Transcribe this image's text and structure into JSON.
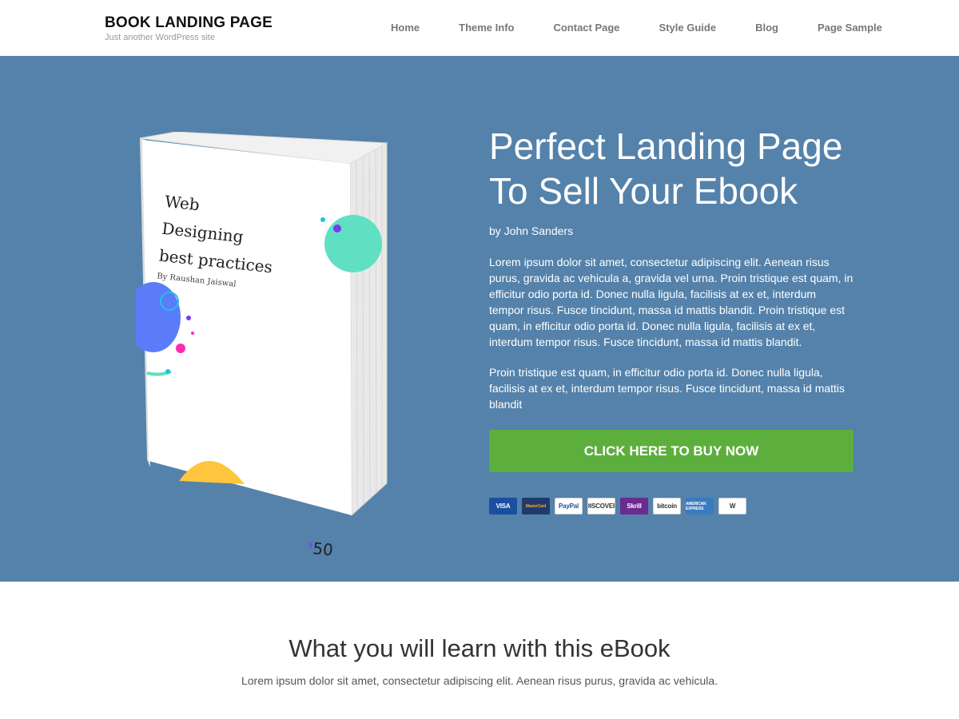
{
  "site": {
    "title": "BOOK LANDING PAGE",
    "tagline": "Just another WordPress site"
  },
  "nav": {
    "items": [
      {
        "label": "Home"
      },
      {
        "label": "Theme Info"
      },
      {
        "label": "Contact Page"
      },
      {
        "label": "Style Guide"
      },
      {
        "label": "Blog"
      },
      {
        "label": "Page Sample"
      }
    ]
  },
  "book": {
    "title_lines": [
      "Web",
      "Designing",
      "best practices"
    ],
    "author": "By Raushan Jaiswal",
    "price_symbol": "$",
    "price": "50"
  },
  "hero": {
    "title": "Perfect Landing Page To Sell Your Ebook",
    "author": "by John Sanders",
    "paragraph1": "Lorem ipsum dolor sit amet, consectetur adipiscing elit. Aenean risus purus, gravida ac vehicula a, gravida vel urna. Proin tristique est quam, in efficitur odio porta id. Donec nulla ligula, facilisis at ex et, interdum tempor risus. Fusce tincidunt, massa id mattis blandit. Proin tristique est quam, in efficitur odio porta id. Donec nulla ligula, facilisis at ex et, interdum tempor risus. Fusce tincidunt, massa id mattis blandit.",
    "paragraph2": "Proin tristique est quam, in efficitur odio porta id. Donec nulla ligula, facilisis at ex et, interdum tempor risus. Fusce tincidunt, massa id mattis blandit",
    "button_label": "CLICK HERE TO BUY NOW",
    "payments": [
      {
        "label": "VISA",
        "bg": "#1a4fa0",
        "color": "#ffffff"
      },
      {
        "label": "MasterCard",
        "bg": "#1f3b6e",
        "color": "#f5a623"
      },
      {
        "label": "PayPal",
        "bg": "#ffffff",
        "color": "#1a4fa0"
      },
      {
        "label": "DISCOVER",
        "bg": "#ffffff",
        "color": "#333333"
      },
      {
        "label": "Skrill",
        "bg": "#6b2a8f",
        "color": "#ffffff"
      },
      {
        "label": "bitcoin",
        "bg": "#ffffff",
        "color": "#333333"
      },
      {
        "label": "AMERICAN EXPRESS",
        "bg": "#3a7bbf",
        "color": "#ffffff"
      },
      {
        "label": "W",
        "bg": "#ffffff",
        "color": "#333333"
      }
    ]
  },
  "learn": {
    "title": "What you will learn with this eBook",
    "subtitle": "Lorem ipsum dolor sit amet, consectetur adipiscing elit. Aenean risus purus, gravida ac vehicula."
  },
  "colors": {
    "hero_bg": "#5482aa",
    "button_bg": "#5daf3d"
  }
}
